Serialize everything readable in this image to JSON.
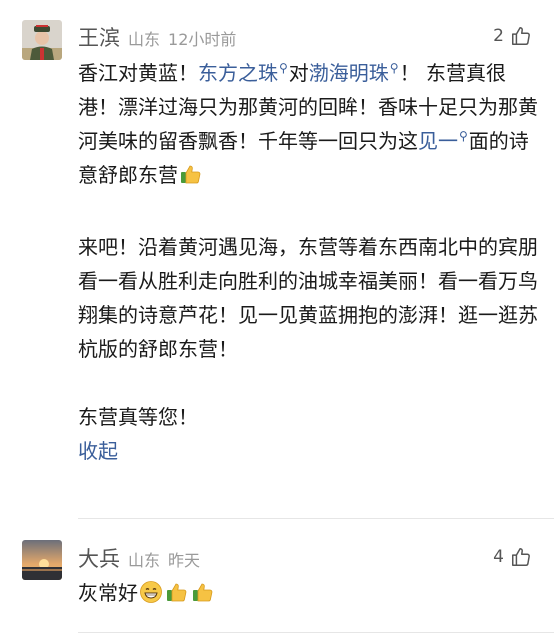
{
  "comments": [
    {
      "user": "王滨",
      "location": "山东",
      "time": "12小时前",
      "likes": "2",
      "avatar_icon": "avatar-person-uniform",
      "p1": {
        "a": "香江对黄蓝！",
        "link1": "东方之珠",
        "b": "对",
        "link2": "渤海明珠",
        "c": "！ 东营真很港！漂洋过海只为那黄河的回眸！香味十足只为那黄河美味的留香飘香！千年等一回只为这",
        "link3": "见一",
        "d": "面的诗意舒郎东营"
      },
      "p2": "来吧！沿着黄河遇见海，东营等着东西南北中的宾朋看一看从胜利走向胜利的油城幸福美丽！看一看万鸟翔集的诗意芦花！见一见黄蓝拥抱的澎湃！逛一逛苏杭版的舒郎东营！",
      "p3": "东营真等您！",
      "collapse_label": "收起",
      "emoji": [
        "thumbs-up-emoji"
      ]
    },
    {
      "user": "大兵",
      "location": "山东",
      "time": "昨天",
      "likes": "4",
      "avatar_icon": "avatar-sunset",
      "text": "灰常好",
      "emoji": [
        "grin-emoji",
        "thumbs-up-emoji",
        "thumbs-up-emoji"
      ]
    }
  ],
  "colors": {
    "link": "#3a5e9a",
    "meta": "#9a9a9a",
    "name": "#555555"
  }
}
